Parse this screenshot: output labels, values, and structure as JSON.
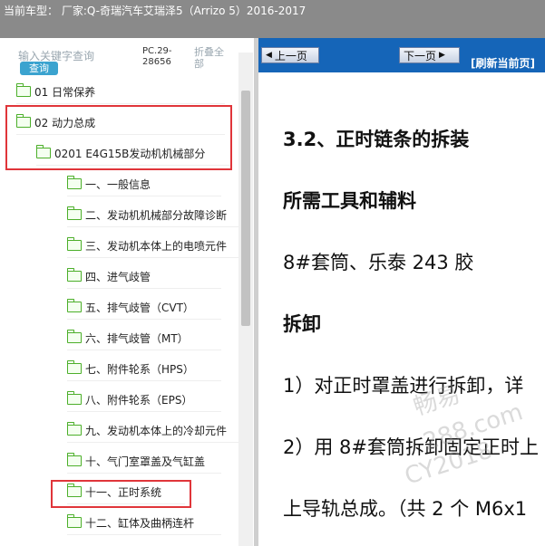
{
  "title_bar": {
    "text": "当前车型： 厂家:Q-奇瑞汽车艾瑞泽5（Arrizo 5）2016-2017"
  },
  "sidebar": {
    "search_hint": "输入关键字查询",
    "search_button": "查询",
    "pc_code": "PC.29-28656",
    "collapse_all": "折叠全部",
    "tree": [
      {
        "label": "01 日常保养"
      },
      {
        "label": "02 动力总成"
      },
      {
        "label": "0201 E4G15B发动机机械部分"
      },
      {
        "label": "一、一般信息"
      },
      {
        "label": "二、发动机机械部分故障诊断"
      },
      {
        "label": "三、发动机本体上的电喷元件"
      },
      {
        "label": "四、进气歧管"
      },
      {
        "label": "五、排气歧管（CVT）"
      },
      {
        "label": "六、排气歧管（MT）"
      },
      {
        "label": "七、附件轮系（HPS）"
      },
      {
        "label": "八、附件轮系（EPS）"
      },
      {
        "label": "九、发动机本体上的冷却元件"
      },
      {
        "label": "十、气门室罩盖及气缸盖"
      },
      {
        "label": "十一、正时系统"
      },
      {
        "label": "十二、缸体及曲柄连杆"
      }
    ]
  },
  "viewer": {
    "prev_label": "上一页",
    "next_label": "下一页",
    "refresh_label": "[刷新当前页]",
    "lines": [
      "3.2、正时链条的拆装",
      "所需工具和辅料",
      "8#套筒、乐泰 243 胶",
      "拆卸",
      "1）对正时罩盖进行拆卸，详",
      "2）用 8#套筒拆卸固定正时上",
      "上导轨总成。（共 2 个 M6x1"
    ],
    "watermark": [
      "畅易",
      "288.com",
      "CY2018"
    ]
  },
  "colors": {
    "nav_blue": "#1565b8",
    "highlight_red": "#e0353a",
    "folder_green": "#4caf2a",
    "search_blue": "#3ba3cf"
  }
}
